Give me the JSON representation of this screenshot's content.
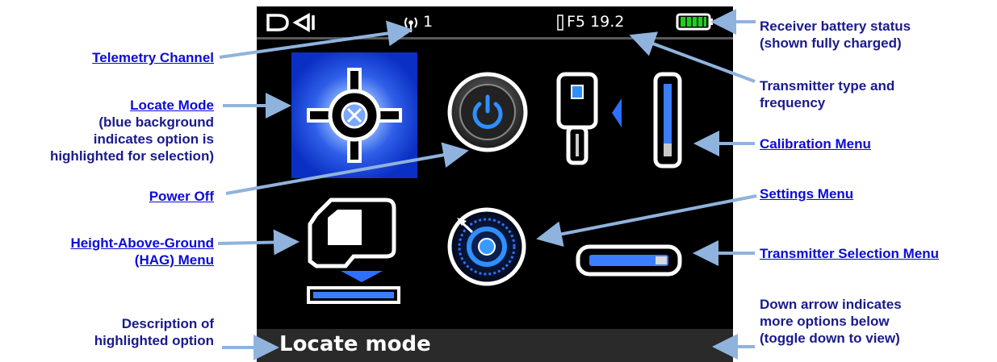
{
  "screen": {
    "logo": "DCI",
    "telemetry_channel": "1",
    "transmitter_type_frequency": "F5 19.2",
    "description": "Locate mode"
  },
  "callouts": {
    "telemetry_channel": "Telemetry Channel",
    "locate_mode": "Locate Mode",
    "locate_mode_note": [
      "(blue background",
      "indicates option is",
      "highlighted for selection)"
    ],
    "power_off": "Power Off",
    "hag_menu": [
      "Height-Above-Ground",
      "(HAG) Menu"
    ],
    "description_of_option": [
      "Description of",
      "highlighted option"
    ],
    "battery_status": [
      "Receiver battery status",
      "(shown fully charged)"
    ],
    "transmitter_type": [
      "Transmitter type and",
      "frequency"
    ],
    "calibration_menu": "Calibration Menu",
    "settings_menu": "Settings Menu",
    "transmitter_selection_menu": "Transmitter Selection Menu",
    "down_arrow_note": [
      "Down arrow indicates",
      "more options below",
      "(toggle down to view)"
    ]
  },
  "colors": {
    "link": "#0b0bd9",
    "text": "#1a1a8c",
    "callout_arrow": "#8fb3dd",
    "highlight_blue": "#0a2fc4",
    "battery": "#22cc22"
  }
}
